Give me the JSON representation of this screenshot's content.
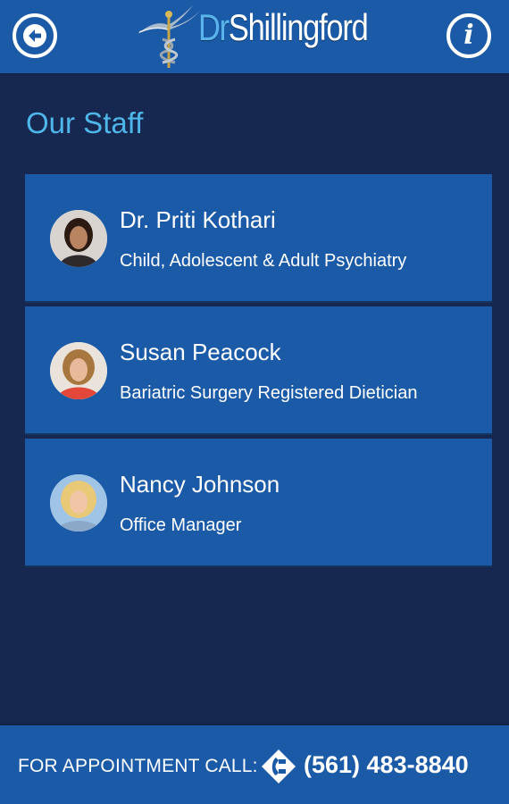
{
  "header": {
    "logo": {
      "prefix": "Dr",
      "name": "Shillingford"
    },
    "back_icon": "arrow-left-icon",
    "info_icon": "info-icon",
    "info_glyph": "i"
  },
  "page": {
    "title": "Our Staff"
  },
  "staff": [
    {
      "name": "Dr. Priti Kothari",
      "role": "Child, Adolescent & Adult Psychiatry",
      "avatar_hair": "#2a1a12",
      "avatar_top": "#2e2a2c"
    },
    {
      "name": "Susan Peacock",
      "role": "Bariatric Surgery Registered Dietician",
      "avatar_hair": "#a8773f",
      "avatar_top": "#e2473a"
    },
    {
      "name": "Nancy Johnson",
      "role": "Office Manager",
      "avatar_hair": "#e8c977",
      "avatar_top": "#8ca8c8"
    }
  ],
  "footer": {
    "appointment_label": "FOR APPOINTMENT CALL:",
    "phone_icon": "phone-diamond-icon",
    "phone": "(561) 483-8840"
  },
  "colors": {
    "header_blue": "#1b5aa6",
    "background_navy": "#16284f",
    "title_cyan": "#4fb6ea"
  }
}
